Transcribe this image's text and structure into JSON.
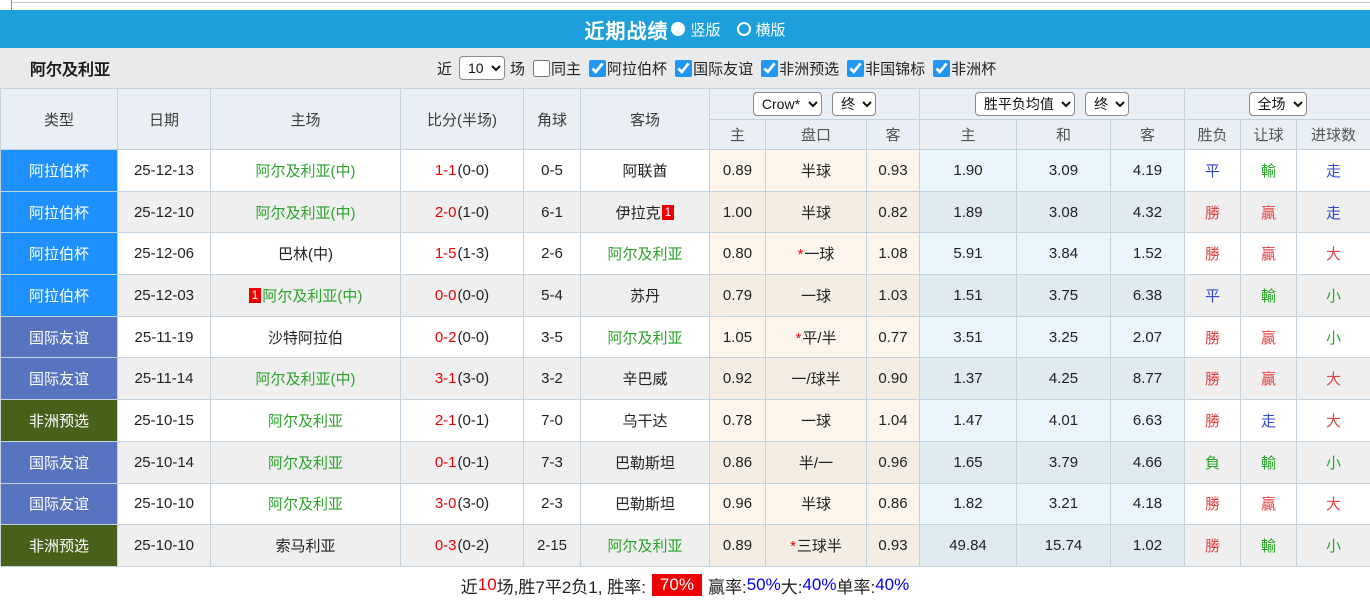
{
  "title_bar": {
    "title": "近期战绩",
    "vertical_label": "竖版",
    "horizontal_label": "横版",
    "selected": "竖版"
  },
  "filter_bar": {
    "team": "阿尔及利亚",
    "near_label": "近",
    "count_value": "10",
    "games_label": "场",
    "checkboxes": [
      {
        "label": "同主",
        "checked": false
      },
      {
        "label": "阿拉伯杯",
        "checked": true
      },
      {
        "label": "国际友谊",
        "checked": true
      },
      {
        "label": "非洲预选",
        "checked": true
      },
      {
        "label": "非国锦标",
        "checked": true
      },
      {
        "label": "非洲杯",
        "checked": true
      }
    ]
  },
  "table": {
    "main_headers": [
      "类型",
      "日期",
      "主场",
      "比分(半场)",
      "角球",
      "客场"
    ],
    "sub_headers": [
      "主",
      "盘口",
      "客",
      "主",
      "和",
      "客",
      "胜负",
      "让球",
      "进球数"
    ],
    "selects": {
      "bookmaker": "Crow*",
      "final1": "终",
      "odds_type": "胜平负均值",
      "final2": "终",
      "scope": "全场"
    },
    "rows": [
      {
        "type": "阿拉伯杯",
        "date": "25-12-13",
        "home": {
          "name": "阿尔及利亚(中)",
          "green": true,
          "badge": ""
        },
        "score": "1-1",
        "half": "(0-0)",
        "corners": "0-5",
        "away": {
          "name": "阿联酋",
          "green": false,
          "badge": ""
        },
        "asia": {
          "home": "0.89",
          "line": "半球",
          "star": false,
          "away": "0.93"
        },
        "euro": {
          "home": "1.90",
          "draw": "3.09",
          "away": "4.19"
        },
        "results": [
          {
            "t": "平",
            "c": "blue"
          },
          {
            "t": "輸",
            "c": "green"
          },
          {
            "t": "走",
            "c": "blue"
          }
        ]
      },
      {
        "type": "阿拉伯杯",
        "date": "25-12-10",
        "home": {
          "name": "阿尔及利亚(中)",
          "green": true,
          "badge": ""
        },
        "score": "2-0",
        "half": "(1-0)",
        "corners": "6-1",
        "away": {
          "name": "伊拉克",
          "green": false,
          "badge": "1"
        },
        "asia": {
          "home": "1.00",
          "line": "半球",
          "star": false,
          "away": "0.82"
        },
        "euro": {
          "home": "1.89",
          "draw": "3.08",
          "away": "4.32"
        },
        "results": [
          {
            "t": "勝",
            "c": "red"
          },
          {
            "t": "贏",
            "c": "red"
          },
          {
            "t": "走",
            "c": "blue"
          }
        ]
      },
      {
        "type": "阿拉伯杯",
        "date": "25-12-06",
        "home": {
          "name": "巴林(中)",
          "green": false,
          "badge": ""
        },
        "score": "1-5",
        "half": "(1-3)",
        "corners": "2-6",
        "away": {
          "name": "阿尔及利亚",
          "green": true,
          "badge": ""
        },
        "asia": {
          "home": "0.80",
          "line": "一球",
          "star": true,
          "away": "1.08"
        },
        "euro": {
          "home": "5.91",
          "draw": "3.84",
          "away": "1.52"
        },
        "results": [
          {
            "t": "勝",
            "c": "red"
          },
          {
            "t": "贏",
            "c": "red"
          },
          {
            "t": "大",
            "c": "red"
          }
        ]
      },
      {
        "type": "阿拉伯杯",
        "date": "25-12-03",
        "home": {
          "name": "阿尔及利亚(中)",
          "green": true,
          "badge": "1"
        },
        "score": "0-0",
        "half": "(0-0)",
        "corners": "5-4",
        "away": {
          "name": "苏丹",
          "green": false,
          "badge": ""
        },
        "asia": {
          "home": "0.79",
          "line": "一球",
          "star": false,
          "away": "1.03"
        },
        "euro": {
          "home": "1.51",
          "draw": "3.75",
          "away": "6.38"
        },
        "results": [
          {
            "t": "平",
            "c": "blue"
          },
          {
            "t": "輸",
            "c": "green"
          },
          {
            "t": "小",
            "c": "green"
          }
        ]
      },
      {
        "type": "国际友谊",
        "date": "25-11-19",
        "home": {
          "name": "沙特阿拉伯",
          "green": false,
          "badge": ""
        },
        "score": "0-2",
        "half": "(0-0)",
        "corners": "3-5",
        "away": {
          "name": "阿尔及利亚",
          "green": true,
          "badge": ""
        },
        "asia": {
          "home": "1.05",
          "line": "平/半",
          "star": true,
          "away": "0.77"
        },
        "euro": {
          "home": "3.51",
          "draw": "3.25",
          "away": "2.07"
        },
        "results": [
          {
            "t": "勝",
            "c": "red"
          },
          {
            "t": "贏",
            "c": "red"
          },
          {
            "t": "小",
            "c": "green"
          }
        ]
      },
      {
        "type": "国际友谊",
        "date": "25-11-14",
        "home": {
          "name": "阿尔及利亚(中)",
          "green": true,
          "badge": ""
        },
        "score": "3-1",
        "half": "(3-0)",
        "corners": "3-2",
        "away": {
          "name": "辛巴威",
          "green": false,
          "badge": ""
        },
        "asia": {
          "home": "0.92",
          "line": "一/球半",
          "star": false,
          "away": "0.90"
        },
        "euro": {
          "home": "1.37",
          "draw": "4.25",
          "away": "8.77"
        },
        "results": [
          {
            "t": "勝",
            "c": "red"
          },
          {
            "t": "贏",
            "c": "red"
          },
          {
            "t": "大",
            "c": "red"
          }
        ]
      },
      {
        "type": "非洲预选",
        "date": "25-10-15",
        "home": {
          "name": "阿尔及利亚",
          "green": true,
          "badge": ""
        },
        "score": "2-1",
        "half": "(0-1)",
        "corners": "7-0",
        "away": {
          "name": "乌干达",
          "green": false,
          "badge": ""
        },
        "asia": {
          "home": "0.78",
          "line": "一球",
          "star": false,
          "away": "1.04"
        },
        "euro": {
          "home": "1.47",
          "draw": "4.01",
          "away": "6.63"
        },
        "results": [
          {
            "t": "勝",
            "c": "red"
          },
          {
            "t": "走",
            "c": "blue"
          },
          {
            "t": "大",
            "c": "red"
          }
        ]
      },
      {
        "type": "国际友谊",
        "date": "25-10-14",
        "home": {
          "name": "阿尔及利亚",
          "green": true,
          "badge": ""
        },
        "score": "0-1",
        "half": "(0-1)",
        "corners": "7-3",
        "away": {
          "name": "巴勒斯坦",
          "green": false,
          "badge": ""
        },
        "asia": {
          "home": "0.86",
          "line": "半/一",
          "star": false,
          "away": "0.96"
        },
        "euro": {
          "home": "1.65",
          "draw": "3.79",
          "away": "4.66"
        },
        "results": [
          {
            "t": "負",
            "c": "green"
          },
          {
            "t": "輸",
            "c": "green"
          },
          {
            "t": "小",
            "c": "green"
          }
        ]
      },
      {
        "type": "国际友谊",
        "date": "25-10-10",
        "home": {
          "name": "阿尔及利亚",
          "green": true,
          "badge": ""
        },
        "score": "3-0",
        "half": "(3-0)",
        "corners": "2-3",
        "away": {
          "name": "巴勒斯坦",
          "green": false,
          "badge": ""
        },
        "asia": {
          "home": "0.96",
          "line": "半球",
          "star": false,
          "away": "0.86"
        },
        "euro": {
          "home": "1.82",
          "draw": "3.21",
          "away": "4.18"
        },
        "results": [
          {
            "t": "勝",
            "c": "red"
          },
          {
            "t": "贏",
            "c": "red"
          },
          {
            "t": "大",
            "c": "red"
          }
        ]
      },
      {
        "type": "非洲预选",
        "date": "25-10-10",
        "home": {
          "name": "索马利亚",
          "green": false,
          "badge": ""
        },
        "score": "0-3",
        "half": "(0-2)",
        "corners": "2-15",
        "away": {
          "name": "阿尔及利亚",
          "green": true,
          "badge": ""
        },
        "asia": {
          "home": "0.89",
          "line": "三球半",
          "star": true,
          "away": "0.93"
        },
        "euro": {
          "home": "49.84",
          "draw": "15.74",
          "away": "1.02"
        },
        "results": [
          {
            "t": "勝",
            "c": "red"
          },
          {
            "t": "輸",
            "c": "green"
          },
          {
            "t": "小",
            "c": "green"
          }
        ]
      }
    ]
  },
  "summary": {
    "segments": [
      {
        "t": "近",
        "c": "dark"
      },
      {
        "t": "10",
        "c": "red"
      },
      {
        "t": "场,胜7平2负1, 胜率:",
        "c": "dark"
      },
      {
        "t": "70%",
        "c": "badge"
      },
      {
        "t": "赢率:",
        "c": "dark"
      },
      {
        "t": "50%",
        "c": "blue"
      },
      {
        "t": " 大:",
        "c": "dark"
      },
      {
        "t": "40%",
        "c": "blue"
      },
      {
        "t": " 单率:",
        "c": "dark"
      },
      {
        "t": "40%",
        "c": "blue"
      }
    ]
  },
  "colors": {
    "header_blue": "#1C9FDA",
    "type_bg": {
      "阿拉伯杯": "#1E90FF",
      "国际友谊": "#5873BF",
      "非洲预选": "#47601A"
    },
    "team_green": "#2BA32B",
    "score_red": "#EE0000",
    "badge_red": "#EE0000",
    "result": {
      "red": "#E04444",
      "green": "#2BA32B",
      "blue": "#3348CC"
    },
    "summary_blue": "#0000EE"
  }
}
